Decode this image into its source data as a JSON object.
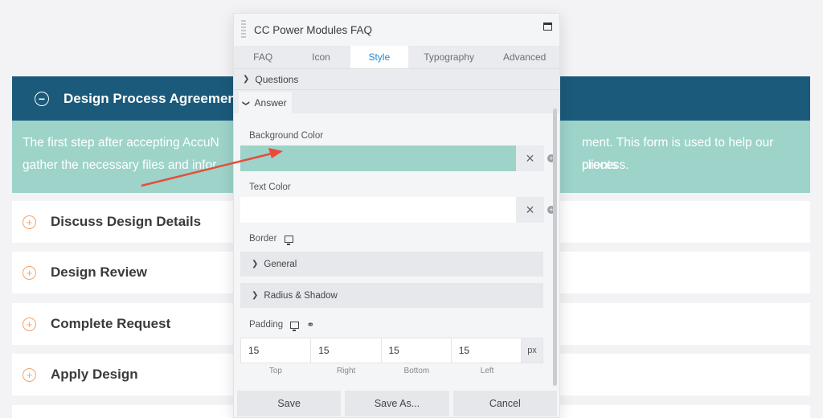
{
  "faq": {
    "open_item": {
      "title": "Design Process Agreement",
      "answer_line1": "The first step after accepting AccuN",
      "answer_line1_end": "ment. This form is used to help our clients",
      "answer_line2": "gather the necessary files and infor",
      "answer_line2_end": "process."
    },
    "items": [
      {
        "title": "Discuss Design Details"
      },
      {
        "title": "Design Review"
      },
      {
        "title": "Complete Request"
      },
      {
        "title": "Apply Design"
      }
    ]
  },
  "panel": {
    "title": "CC Power Modules FAQ",
    "tabs": [
      "FAQ",
      "Icon",
      "Style",
      "Typography",
      "Advanced"
    ],
    "active_tab": "Style",
    "sections": {
      "questions": "Questions",
      "answer": "Answer"
    },
    "fields": {
      "background_color_label": "Background Color",
      "background_color_value": "#9dd3c9",
      "text_color_label": "Text Color",
      "text_color_value": "#ffffff",
      "border_label": "Border",
      "border_groups": [
        "General",
        "Radius & Shadow"
      ],
      "padding_label": "Padding",
      "padding": {
        "top": "15",
        "right": "15",
        "bottom": "15",
        "left": "15",
        "unit": "px",
        "labels": [
          "Top",
          "Right",
          "Bottom",
          "Left"
        ]
      }
    },
    "buttons": {
      "save": "Save",
      "save_as": "Save As...",
      "cancel": "Cancel"
    }
  },
  "colors": {
    "header_bg": "#1b5a7a",
    "answer_bg": "#9dd3c9",
    "accent_tab": "#1a8ad4",
    "item_icon": "#f0a36e",
    "annotation_arrow": "#e74c3c"
  },
  "icons": {
    "open_item": "minus-circle-icon",
    "closed_item": "plus-circle-icon",
    "clear": "close-icon",
    "responsive": "monitor-icon",
    "link": "unlink-icon"
  }
}
